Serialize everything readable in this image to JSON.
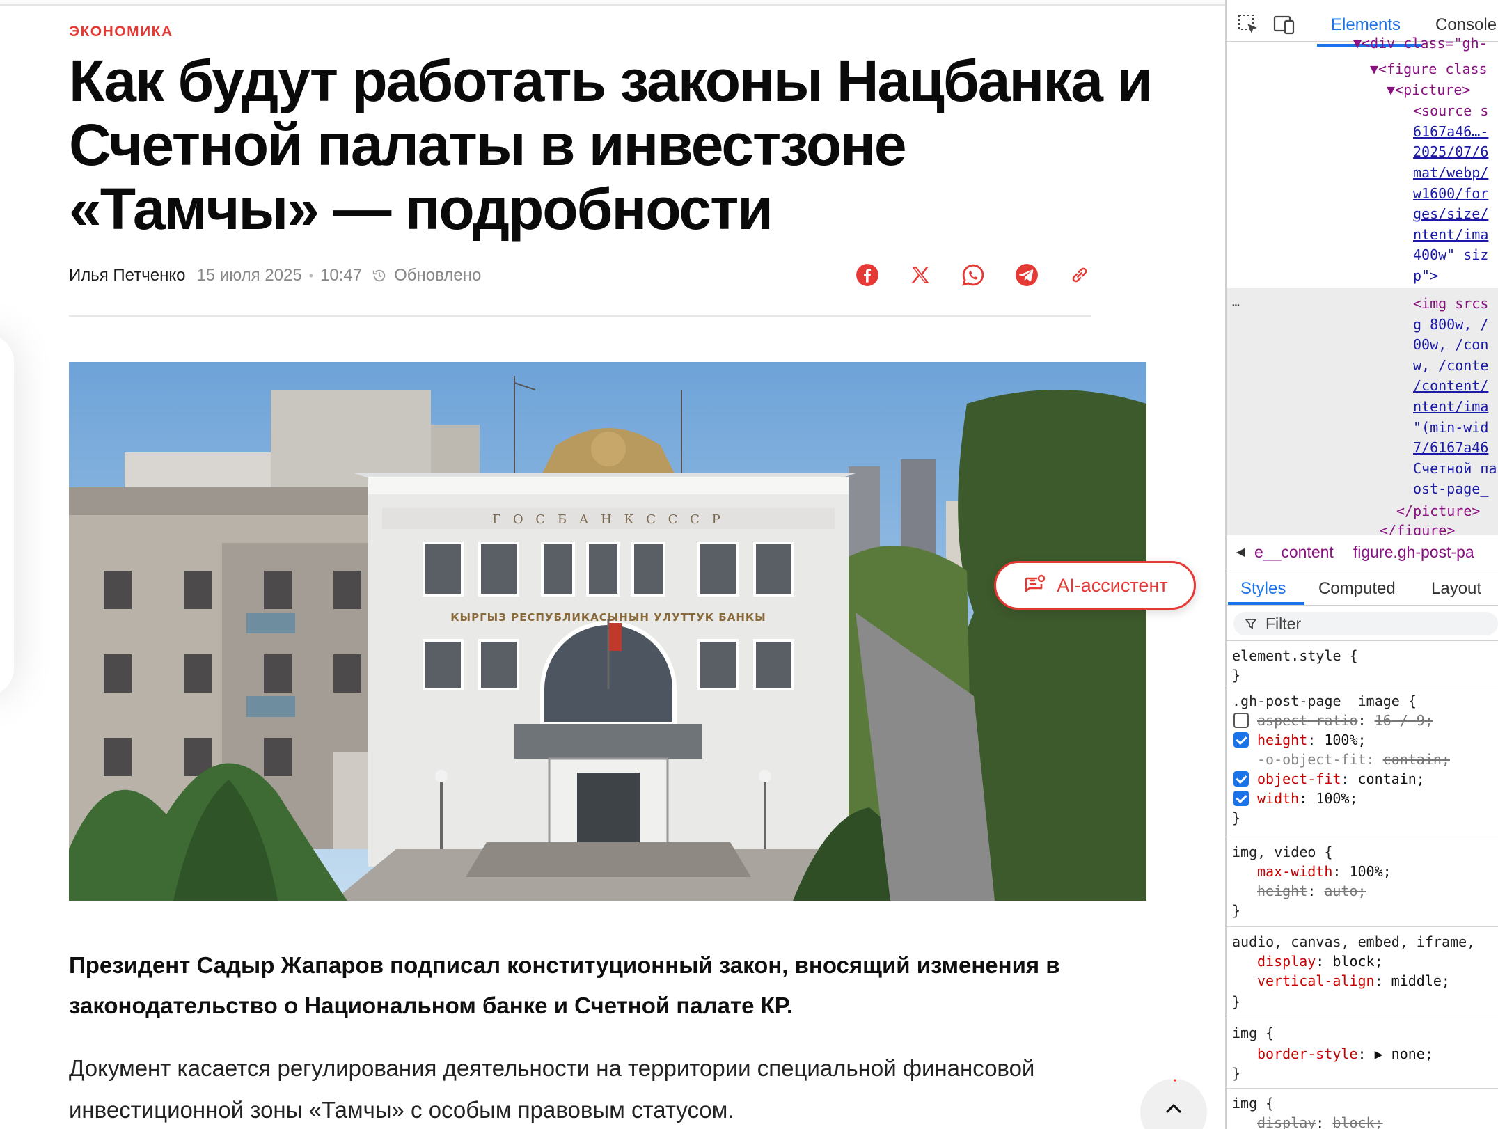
{
  "article": {
    "category": "ЭКОНОМИКА",
    "title": "Как будут работать законы Нацбанка и Счетной палаты в инвестзоне «Тамчы» — подробности",
    "author": "Илья Петченко",
    "date": "15 июля 2025",
    "time": "10:47",
    "updated_label": "Обновлено",
    "share_icons": [
      "facebook-icon",
      "x-icon",
      "whatsapp-icon",
      "telegram-icon",
      "link-icon"
    ],
    "photo_sign_top": "Г О С Б А Н К С С С Р",
    "photo_sign_bottom": "КЫРГЫЗ РЕСПУБЛИКАСЫНЫН УЛУТТУК БАНКЫ",
    "ai_assistant_label": "AI-ассистент",
    "lead": "Президент Садыр Жапаров подписал конституционный закон, вносящий изменения в законодательство о Национальном банке и Счетной палате КР.",
    "body": "Документ касается регулирования деятельности на территории специальной финансовой инвестиционной зоны «Тамчы» с особым правовым статусом."
  },
  "devtools": {
    "tabs": [
      "Elements",
      "Console"
    ],
    "active_tab": "Elements",
    "dom_lines": [
      "▼<div class=\"gh-",
      "▼<figure class",
      "▼<picture>",
      "<source s",
      "6167a46…-",
      "2025/07/6",
      "mat/webp/",
      "w1600/for",
      "ges/size/",
      "ntent/ima",
      "400w\" siz",
      "p\">",
      "<img srcs",
      "g 800w, /",
      "00w, /con",
      "w, /conte",
      "/content/",
      "ntent/ima",
      "\"(min-wid",
      "7/6167a46",
      "Счетной па",
      "ost-page_",
      "</picture>",
      "</figure>"
    ],
    "ellipsis": "…",
    "breadcrumbs": [
      "e__content",
      "figure.gh-post-pa"
    ],
    "sub_tabs": [
      "Styles",
      "Computed",
      "Layout"
    ],
    "active_sub_tab": "Styles",
    "filter_placeholder": "Filter",
    "rules": [
      {
        "selector": "element.style {",
        "props": []
      },
      {
        "selector": ".gh-post-page__image {",
        "props": [
          {
            "name": "aspect-ratio",
            "value": "16 / 9;",
            "checked": false,
            "struck": true
          },
          {
            "name": "height",
            "value": "100%;",
            "checked": true,
            "struck": false
          },
          {
            "name": "-o-object-fit",
            "value": "contain;",
            "checked": null,
            "struck": true,
            "dim": true
          },
          {
            "name": "object-fit",
            "value": "contain;",
            "checked": true,
            "struck": false
          },
          {
            "name": "width",
            "value": "100%;",
            "checked": true,
            "struck": false
          }
        ]
      },
      {
        "selector": "img, video {",
        "props": [
          {
            "name": "max-width",
            "value": "100%;",
            "checked": null,
            "struck": false
          },
          {
            "name": "height",
            "value": "auto;",
            "checked": null,
            "struck": true
          }
        ]
      },
      {
        "selector": "audio, canvas, embed, iframe,",
        "props": [
          {
            "name": "display",
            "value": "block;",
            "checked": null,
            "struck": false
          },
          {
            "name": "vertical-align",
            "value": "middle;",
            "checked": null,
            "struck": false
          }
        ]
      },
      {
        "selector": "img {",
        "props": [
          {
            "name": "border-style",
            "value": "▶ none;",
            "checked": null,
            "struck": false
          }
        ]
      },
      {
        "selector": "img {",
        "props": [
          {
            "name": "display",
            "value": "block;",
            "checked": null,
            "struck": true
          }
        ]
      }
    ],
    "close_brace": "}"
  },
  "colors": {
    "accent_red": "#e53935",
    "devtools_blue": "#1a73e8",
    "dom_tag": "#881280",
    "css_prop": "#c80000"
  }
}
